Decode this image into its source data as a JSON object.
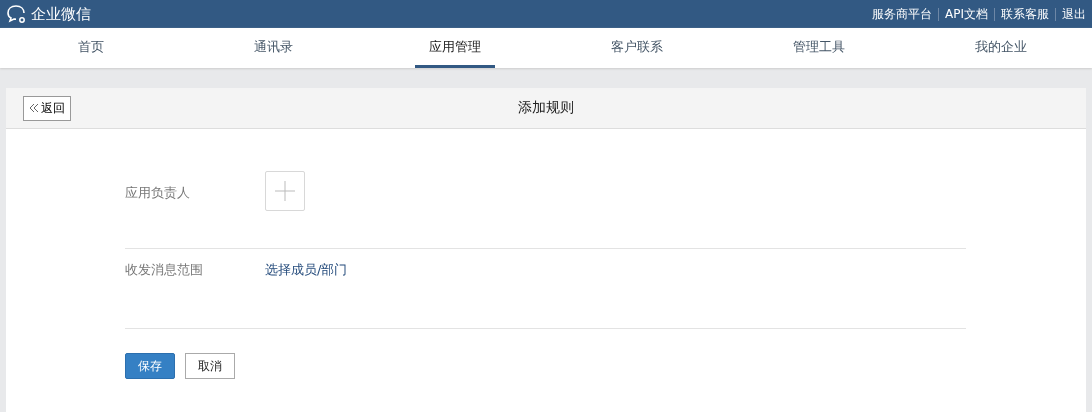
{
  "brand": {
    "name": "企业微信"
  },
  "top_links": [
    "服务商平台",
    "API文档",
    "联系客服",
    "退出"
  ],
  "tabs": [
    {
      "label": "首页",
      "selected": false
    },
    {
      "label": "通讯录",
      "selected": false
    },
    {
      "label": "应用管理",
      "selected": true
    },
    {
      "label": "客户联系",
      "selected": false
    },
    {
      "label": "管理工具",
      "selected": false
    },
    {
      "label": "我的企业",
      "selected": false
    }
  ],
  "panel": {
    "back_button": "返回",
    "title": "添加规则"
  },
  "form": [
    {
      "kind": "add",
      "label": "应用负责人"
    },
    {
      "kind": "link",
      "label": "收发消息范围",
      "value": "选择成员/部门"
    }
  ],
  "buttons": {
    "save": "保存",
    "cancel": "取消"
  }
}
